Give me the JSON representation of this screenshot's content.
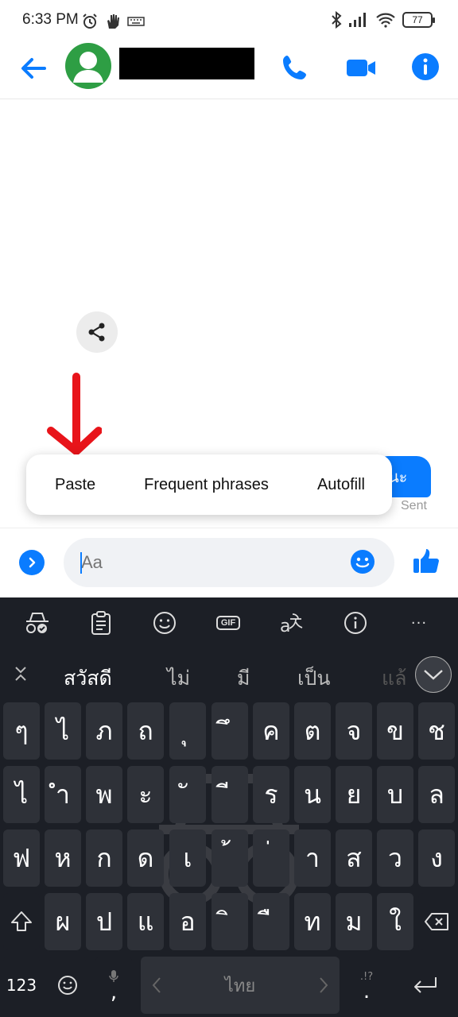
{
  "status_bar": {
    "time": "6:33 PM",
    "battery": "77",
    "icons_left": [
      "alarm-icon",
      "hand-icon",
      "keyboard-icon"
    ],
    "icons_right": [
      "bluetooth-icon",
      "signal-icon",
      "wifi-icon",
      "battery-icon"
    ]
  },
  "header": {
    "contact_name": "",
    "icons": [
      "back-arrow-icon",
      "avatar",
      "phone-icon",
      "video-icon",
      "info-icon"
    ],
    "accent": "#0a7cff"
  },
  "chat": {
    "sent_message": "นะ",
    "sent_status": "Sent"
  },
  "context_menu": {
    "items": [
      "Paste",
      "Frequent phrases",
      "Autofill"
    ]
  },
  "composer": {
    "placeholder": "Aa"
  },
  "keyboard": {
    "toolbar": [
      "incognito-icon",
      "clipboard-icon",
      "emoji-icon",
      "gif-icon",
      "translate-icon",
      "info-icon",
      "more-icon"
    ],
    "gif_label": "GIF",
    "more_label": "···",
    "suggestions": [
      "สวัสดี",
      "ไม่",
      "มี",
      "เป็น",
      "แล้"
    ],
    "rows": [
      [
        "ๆ",
        "ไ",
        "ภ",
        "ถ",
        "ุ",
        "ึ",
        "ค",
        "ต",
        "จ",
        "ข",
        "ช"
      ],
      [
        "ไ",
        "ำ",
        "พ",
        "ะ",
        "ั",
        "ี",
        "ร",
        "น",
        "ย",
        "บ",
        "ล"
      ],
      [
        "ฟ",
        "ห",
        "ก",
        "ด",
        "เ",
        "้",
        "่",
        "า",
        "ส",
        "ว",
        "ง"
      ],
      [
        "ผ",
        "ป",
        "แ",
        "อ",
        "ิ",
        "ื",
        "ท",
        "ม",
        "ใ"
      ]
    ],
    "numbers_label": "123",
    "comma": ",",
    "period": ".",
    "punct_hint": ".!?",
    "space_label": "ไทย"
  }
}
